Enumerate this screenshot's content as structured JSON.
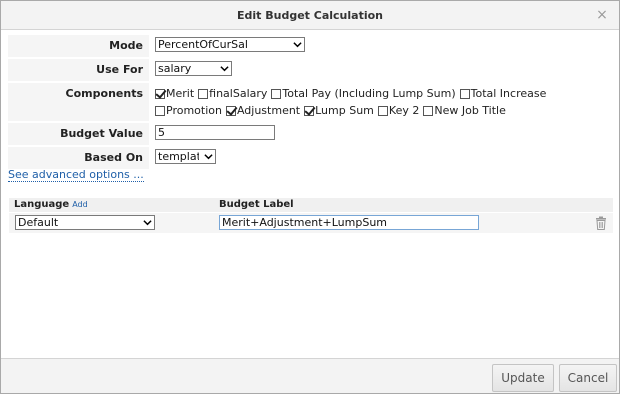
{
  "dialog": {
    "title": "Edit Budget Calculation",
    "close_glyph": "×"
  },
  "form": {
    "mode": {
      "label": "Mode",
      "value": "PercentOfCurSal"
    },
    "use_for": {
      "label": "Use For",
      "value": "salary"
    },
    "components": {
      "label": "Components",
      "items": [
        {
          "label": "Merit",
          "checked": true
        },
        {
          "label": "finalSalary",
          "checked": false
        },
        {
          "label": "Total Pay (Including Lump Sum)",
          "checked": false
        },
        {
          "label": "Total Increase",
          "checked": false
        },
        {
          "label": "Promotion",
          "checked": false
        },
        {
          "label": "Adjustment",
          "checked": true
        },
        {
          "label": "Lump Sum",
          "checked": true
        },
        {
          "label": "Key 2",
          "checked": false
        },
        {
          "label": "New Job Title",
          "checked": false
        }
      ]
    },
    "budget_value": {
      "label": "Budget Value",
      "value": "5"
    },
    "based_on": {
      "label": "Based On",
      "value": "template"
    }
  },
  "advanced_link": "See advanced options ...",
  "language_table": {
    "col_language": "Language",
    "add_link": "Add",
    "col_budget_label": "Budget Label",
    "row": {
      "language": "Default",
      "budget_label": "Merit+Adjustment+LumpSum"
    }
  },
  "footer": {
    "update_label": "Update",
    "cancel_label": "Cancel"
  },
  "icons": {
    "close": "close-icon",
    "dropdown": "chevron-down-icon",
    "delete": "trash-icon"
  }
}
